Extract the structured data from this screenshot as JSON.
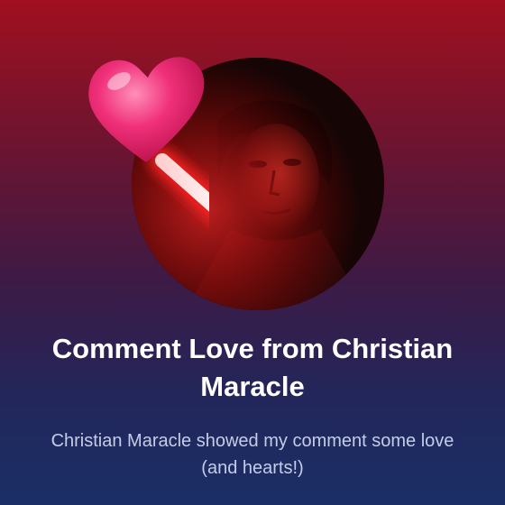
{
  "card": {
    "title": "Comment Love from Christian Maracle",
    "description": "Christian Maracle showed my comment some love (and hearts!)"
  },
  "icons": {
    "avatar": "profile-photo",
    "sticker": "heart-lollipop-icon"
  },
  "colors": {
    "background_top": "#a0101f",
    "background_bottom": "#1a2f66",
    "heart": "#f0307a",
    "glow": "#ff3a3a",
    "subtitle_text": "#c5cce8"
  }
}
